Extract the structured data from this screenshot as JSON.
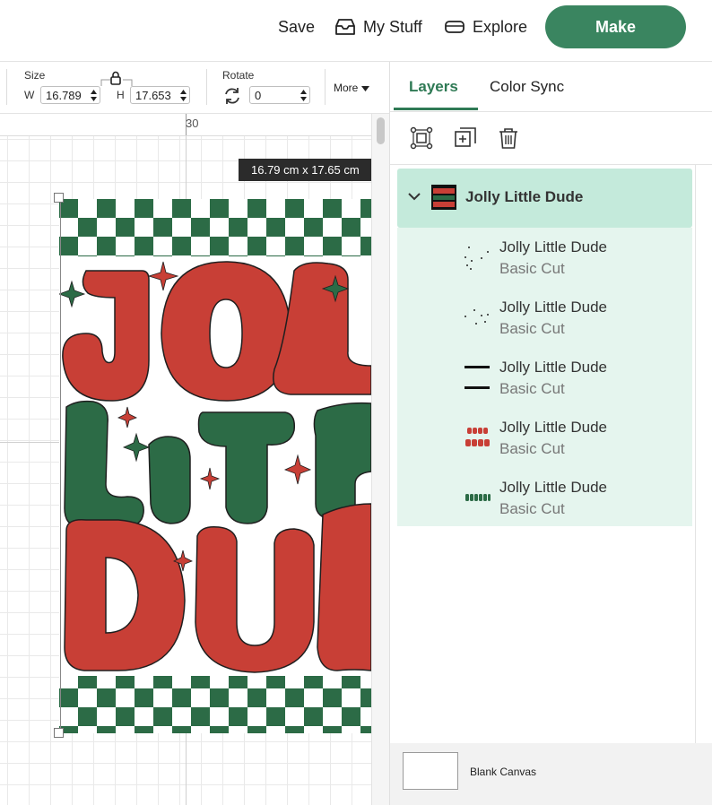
{
  "topbar": {
    "save_label": "Save",
    "my_stuff_label": "My Stuff",
    "explore_label": "Explore",
    "make_label": "Make"
  },
  "toolbar": {
    "size_label": "Size",
    "w_label": "W",
    "w_value": "16.789",
    "h_label": "H",
    "h_value": "17.653",
    "rotate_label": "Rotate",
    "rotate_value": "0",
    "more_label": "More"
  },
  "canvas": {
    "ruler_mark": "30",
    "dimensions_tooltip": "16.79  cm x 17.65  cm",
    "colors": {
      "red": "#c83f36",
      "green": "#2c6b46",
      "outline": "#1f1f1f"
    }
  },
  "panel": {
    "tabs": [
      {
        "label": "Layers",
        "active": true
      },
      {
        "label": "Color Sync",
        "active": false
      }
    ],
    "group": {
      "name": "Jolly Little Dude",
      "expanded": true
    },
    "layers": [
      {
        "name": "Jolly Little Dude",
        "operation": "Basic Cut",
        "thumb": "dots-thumb"
      },
      {
        "name": "Jolly Little Dude",
        "operation": "Basic Cut",
        "thumb": "small-dots-thumb"
      },
      {
        "name": "Jolly Little Dude",
        "operation": "Basic Cut",
        "thumb": "lines-thumb"
      },
      {
        "name": "Jolly Little Dude",
        "operation": "Basic Cut",
        "thumb": "red-text-thumb"
      },
      {
        "name": "Jolly Little Dude",
        "operation": "Basic Cut",
        "thumb": "green-text-thumb"
      }
    ],
    "footer": {
      "blank_canvas_label": "Blank Canvas"
    }
  }
}
